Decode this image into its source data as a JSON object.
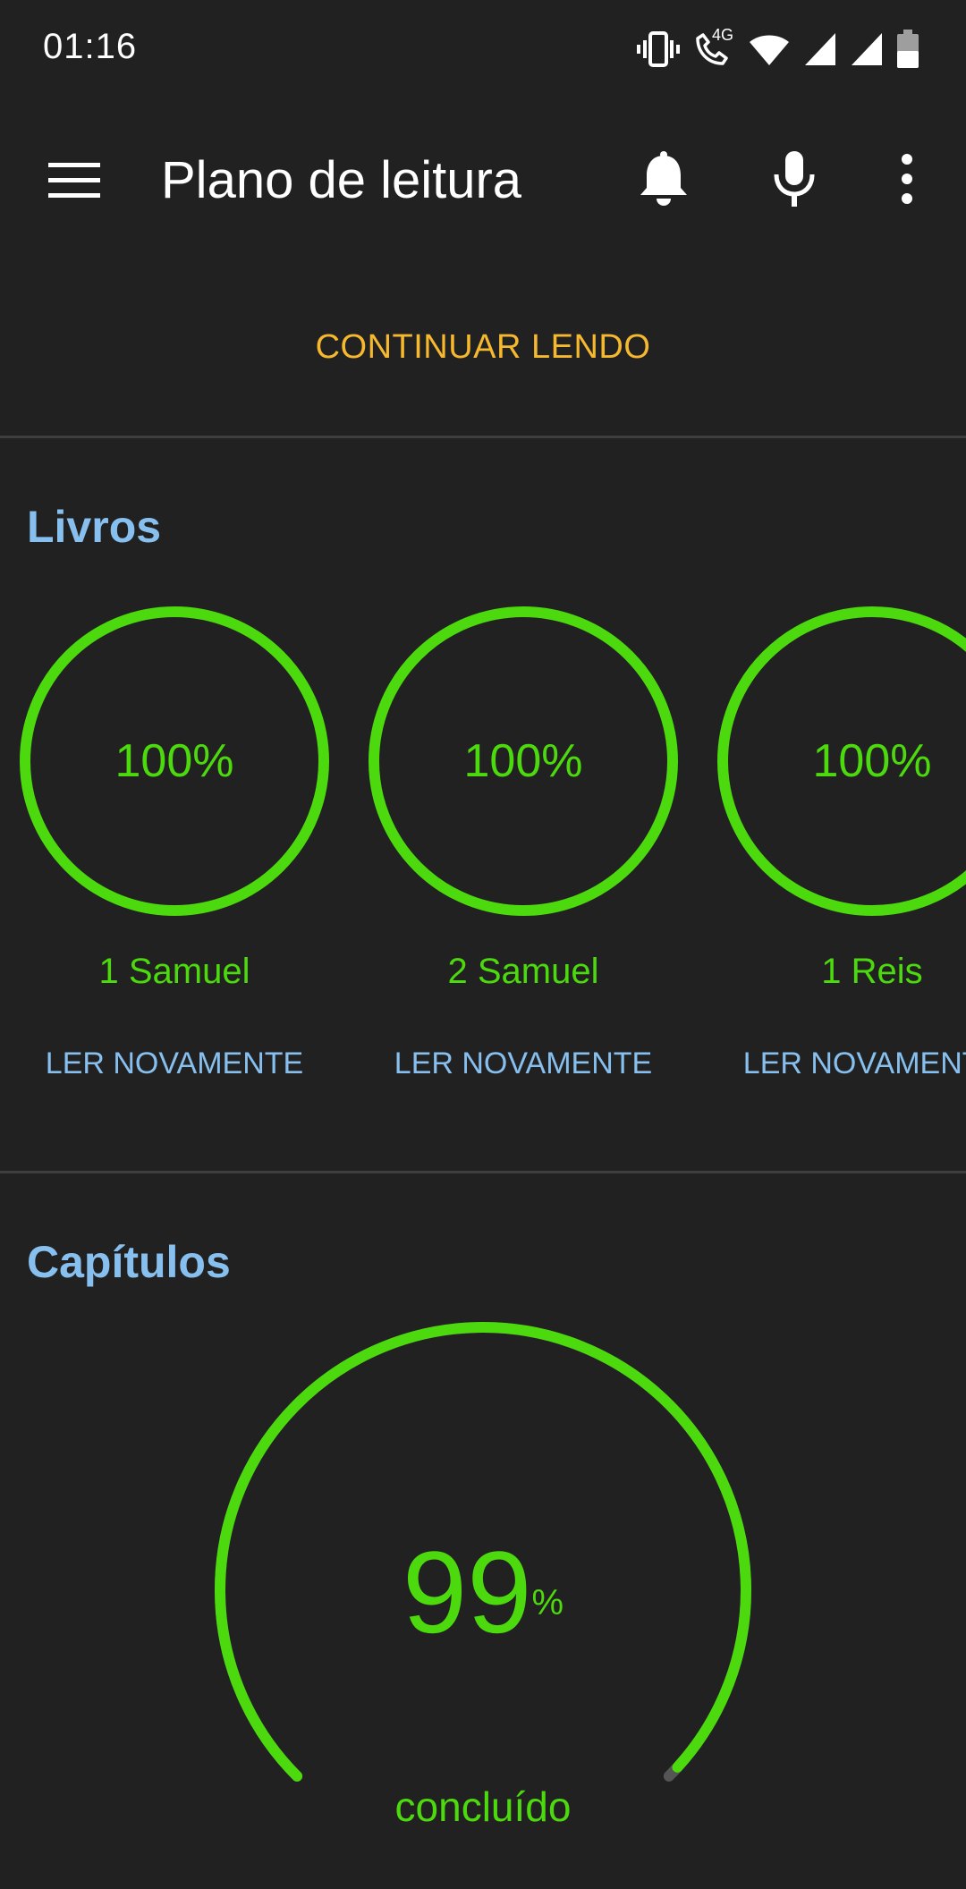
{
  "status_bar": {
    "time": "01:16",
    "icons": [
      "vibrate-icon",
      "wifi-call-icon",
      "wifi-icon",
      "signal-icon",
      "signal-icon",
      "battery-icon"
    ],
    "network_label": "4G"
  },
  "app_bar": {
    "title": "Plano de leitura",
    "icons": [
      "menu-icon",
      "bell-icon",
      "mic-icon",
      "more-vert-icon"
    ]
  },
  "continue_button": "CONTINUAR LENDO",
  "books_section": {
    "title": "Livros",
    "items": [
      {
        "percent": 100,
        "percent_label": "100%",
        "name": "1 Samuel",
        "action": "LER NOVAMENTE"
      },
      {
        "percent": 100,
        "percent_label": "100%",
        "name": "2 Samuel",
        "action": "LER NOVAMENTE"
      },
      {
        "percent": 100,
        "percent_label": "100%",
        "name": "1 Reis",
        "action": "LER NOVAMENTE"
      }
    ]
  },
  "chapters_section": {
    "title": "Capítulos",
    "percent": 99,
    "value": "99",
    "unit": "%",
    "label": "concluído"
  },
  "colors": {
    "background": "#212121",
    "progress": "#4cd90e",
    "accent": "#f5b82e",
    "link": "#87c0ef",
    "track": "#555555"
  }
}
